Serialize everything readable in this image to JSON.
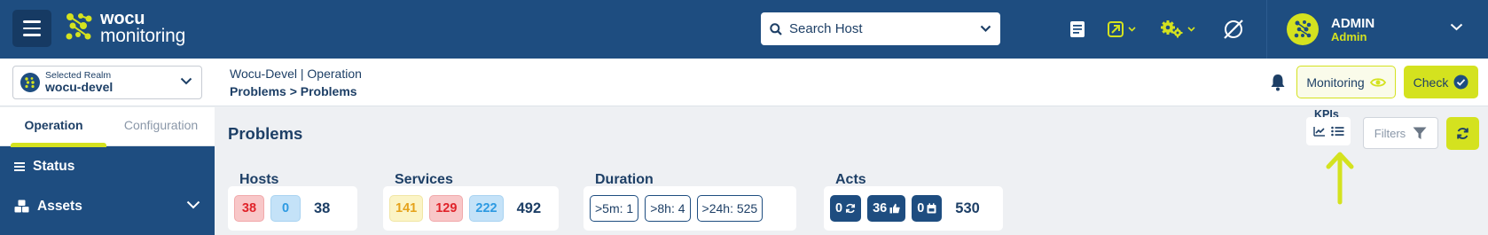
{
  "header": {
    "logo_line1": "wocu",
    "logo_line2": "monitoring",
    "search_placeholder": "Search Host",
    "user_name": "ADMIN",
    "user_role": "Admin"
  },
  "subbar": {
    "realm_label": "Selected Realm",
    "realm_value": "wocu-devel",
    "breadcrumb_top": "Wocu-Devel | Operation",
    "breadcrumb_bottom": "Problems > Problems",
    "monitoring_label": "Monitoring",
    "check_label": "Check"
  },
  "sidebar": {
    "tabs": [
      {
        "label": "Operation",
        "active": true
      },
      {
        "label": "Configuration",
        "active": false
      }
    ],
    "items": [
      {
        "label": "Status",
        "icon": "list-icon"
      },
      {
        "label": "Assets",
        "icon": "cubes-icon"
      }
    ]
  },
  "main": {
    "title": "Problems",
    "kpis_label": "KPIs",
    "filters_label": "Filters"
  },
  "kpis": {
    "hosts": {
      "title": "Hosts",
      "red": "38",
      "blue": "0",
      "total": "38"
    },
    "services": {
      "title": "Services",
      "yellow": "141",
      "red": "129",
      "blue": "222",
      "total": "492"
    },
    "duration": {
      "title": "Duration",
      "d5m": ">5m: 1",
      "d8h": ">8h: 4",
      "d24h": ">24h: 525"
    },
    "acts": {
      "title": "Acts",
      "recheck": "0",
      "ack": "36",
      "downtime": "0",
      "total": "530"
    }
  },
  "colors": {
    "primary": "#1e4d80",
    "accent": "#d4e21f",
    "critical": "#e0232a",
    "warning": "#e5a21b",
    "info": "#2d9ae2"
  }
}
